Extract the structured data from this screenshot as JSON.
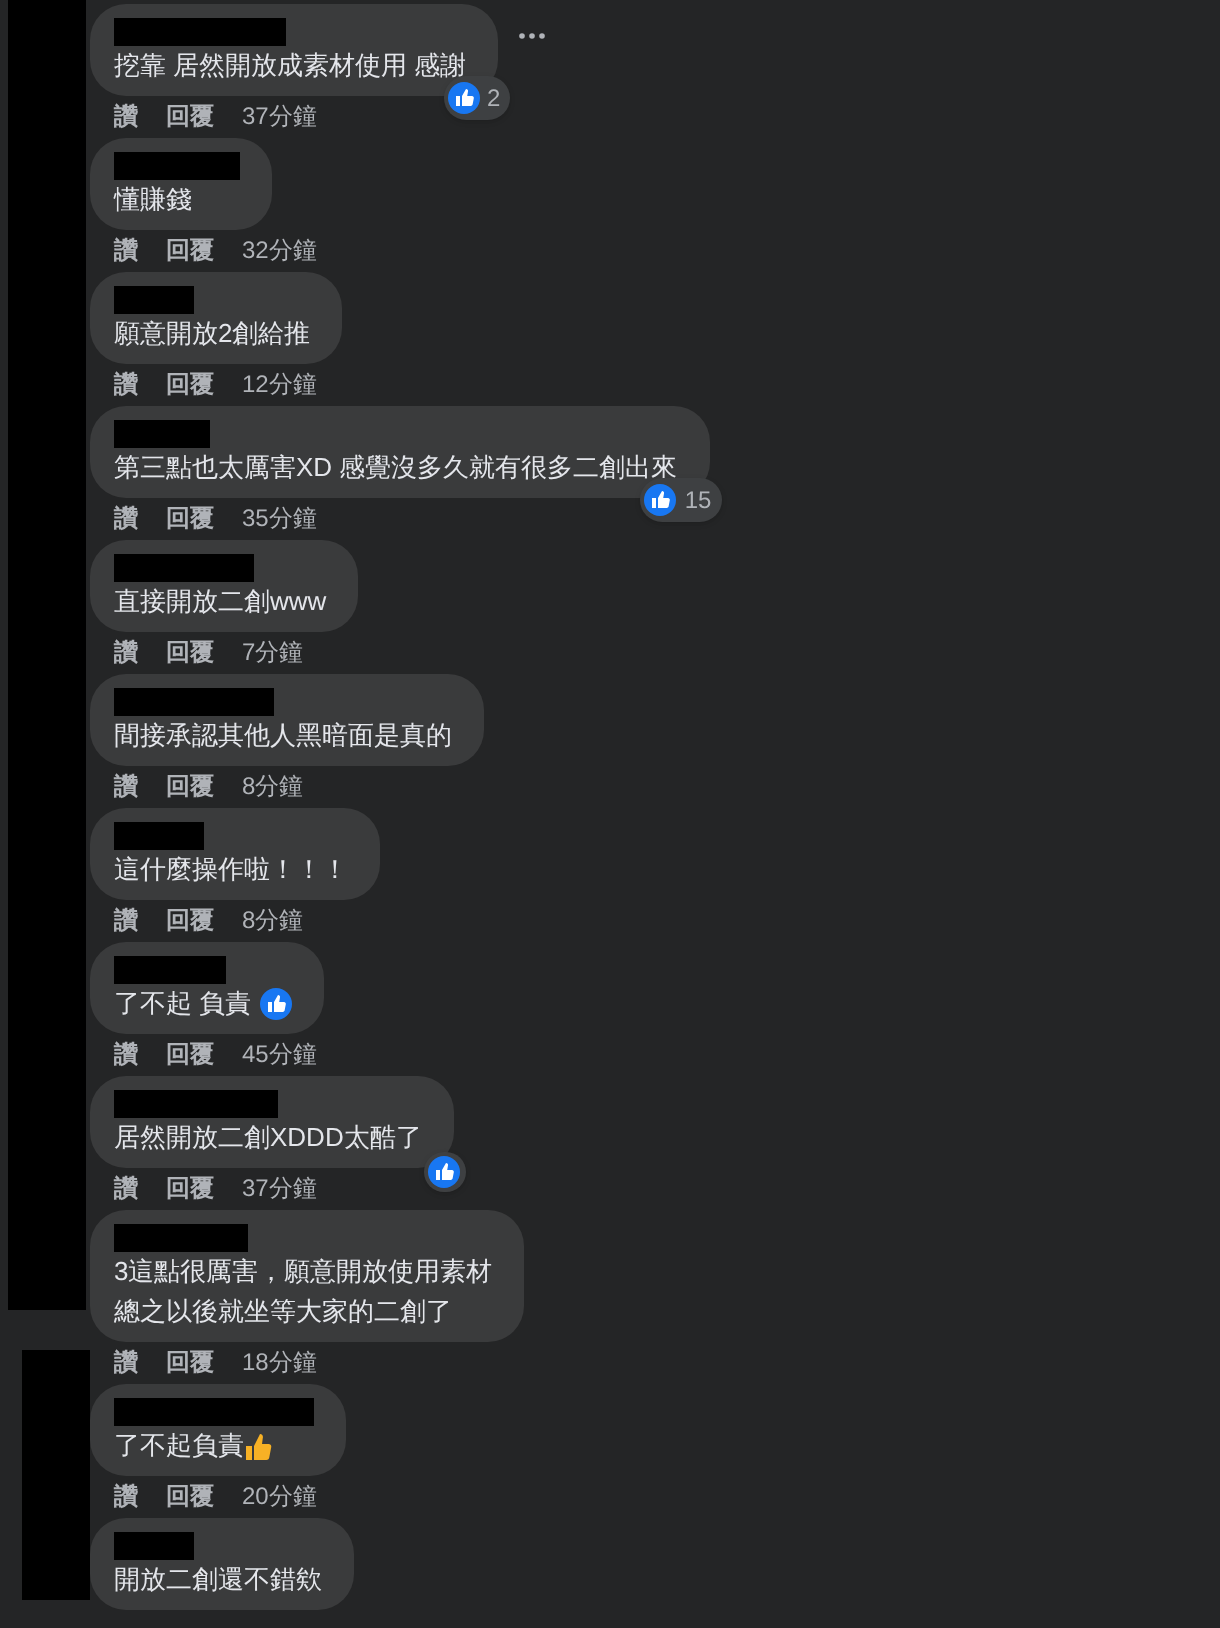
{
  "comments": [
    {
      "kind": "plain",
      "text": "挖靠 居然開放成素材使用 感謝",
      "reacted": true,
      "reaction_count": "2",
      "show_more": true,
      "actions": [
        "讚",
        "回覆",
        "37分鐘"
      ]
    },
    {
      "kind": "plain",
      "text": "懂賺錢",
      "reacted": false,
      "actions": [
        "讚",
        "回覆",
        "32分鐘"
      ]
    },
    {
      "kind": "plain",
      "text": "願意開放2創給推",
      "reacted": false,
      "actions": [
        "讚",
        "回覆",
        "12分鐘"
      ]
    },
    {
      "kind": "plain",
      "text": "第三點也太厲害XD 感覺沒多久就有很多二創出來",
      "reacted": true,
      "reaction_count": "15",
      "actions": [
        "讚",
        "回覆",
        "35分鐘"
      ]
    },
    {
      "kind": "plain",
      "text": "直接開放二創www",
      "reacted": false,
      "actions": [
        "讚",
        "回覆",
        "7分鐘"
      ]
    },
    {
      "kind": "plain",
      "text": "間接承認其他人黑暗面是真的",
      "reacted": false,
      "actions": [
        "讚",
        "回覆",
        "8分鐘"
      ]
    },
    {
      "kind": "plain",
      "text": "這什麼操作啦！！！",
      "reacted": false,
      "actions": [
        "讚",
        "回覆",
        "8分鐘"
      ]
    },
    {
      "kind": "like",
      "text": "了不起 負責",
      "reacted": false,
      "actions": [
        "讚",
        "回覆",
        "45分鐘"
      ]
    },
    {
      "kind": "plain",
      "text": "居然開放二創XDDD太酷了",
      "reacted": true,
      "actions": [
        "讚",
        "回覆",
        "37分鐘"
      ]
    },
    {
      "kind": "plain",
      "lines": [
        "3這點很厲害，願意開放使用素材",
        "總之以後就坐等大家的二創了"
      ],
      "reacted": false,
      "actions": [
        "讚",
        "回覆",
        "18分鐘"
      ]
    },
    {
      "kind": "thumb",
      "text": "了不起負責",
      "reacted": false,
      "actions": [
        "讚",
        "回覆",
        "20分鐘"
      ]
    },
    {
      "kind": "plain",
      "text": "開放二創還不錯欸",
      "reacted": false
    }
  ]
}
